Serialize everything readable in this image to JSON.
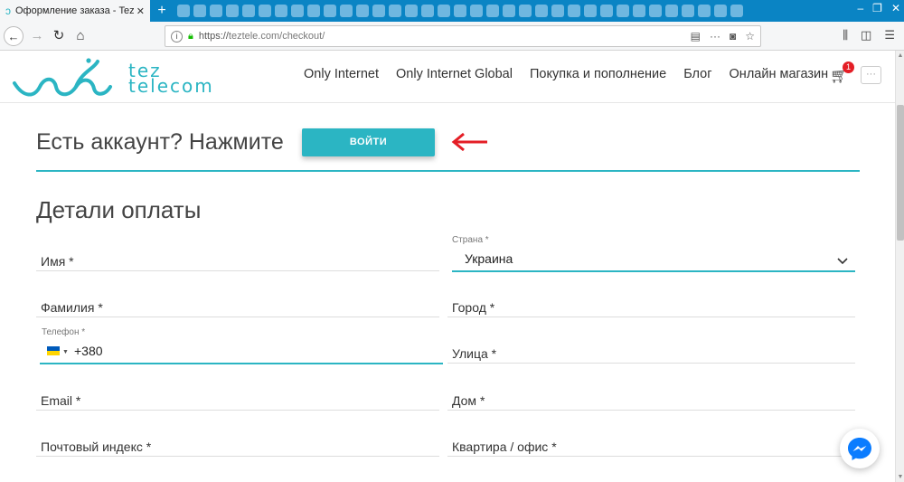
{
  "browser": {
    "tab_title": "Оформление заказа - Tez Tele",
    "url_scheme": "https://",
    "url_rest": "teztele.com/checkout/",
    "nav_more": "···"
  },
  "header": {
    "logo_text_line1": "tez",
    "logo_text_line2": "telecom",
    "menu": [
      {
        "label": "Only Internet"
      },
      {
        "label": "Only Internet Global"
      },
      {
        "label": "Покупка и пополнение"
      },
      {
        "label": "Блог"
      },
      {
        "label": "Онлайн магазин"
      }
    ],
    "cart_count": "1",
    "more_label": "···"
  },
  "login": {
    "prompt": "Есть аккаунт? Нажмите",
    "button": "ВОЙТИ"
  },
  "billing": {
    "title": "Детали оплаты",
    "first_name": "Имя *",
    "last_name": "Фамилия *",
    "phone_label": "Телефон *",
    "phone_value": "+380",
    "email": "Email *",
    "postcode": "Почтовый индекс *",
    "country_label": "Страна *",
    "country_value": "Украина",
    "city": "Город *",
    "street": "Улица *",
    "house": "Дом *",
    "apartment": "Квартира / офис *"
  },
  "colors": {
    "accent": "#2bb5c3",
    "browser_tabbar": "#0a84c4",
    "arrow": "#e41e26"
  }
}
